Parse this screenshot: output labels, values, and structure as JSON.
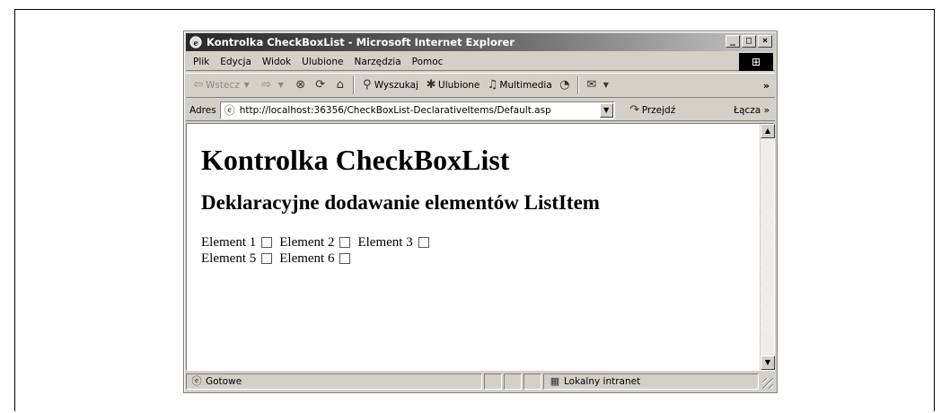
{
  "window": {
    "title": "Kontrolka CheckBoxList - Microsoft Internet Explorer",
    "buttons": {
      "minimize": "_",
      "maximize": "□",
      "close": "×"
    }
  },
  "menu": [
    "Plik",
    "Edycja",
    "Widok",
    "Ulubione",
    "Narzędzia",
    "Pomoc"
  ],
  "toolbar": {
    "back": "Wstecz",
    "search": "Wyszukaj",
    "favorites": "Ulubione",
    "media": "Multimedia",
    "more": "»"
  },
  "address": {
    "label": "Adres",
    "url": "http://localhost:36356/CheckBoxList-DeclarativeItems/Default.asp",
    "go": "Przejdź",
    "links": "Łącza »"
  },
  "page": {
    "heading": "Kontrolka CheckBoxList",
    "subheading": "Deklaracyjne dodawanie elementów ListItem",
    "checkbox_rows": [
      [
        "Element 1",
        "Element 2",
        "Element 3"
      ],
      [
        "Element 5",
        "Element 6"
      ]
    ]
  },
  "status": {
    "text": "Gotowe",
    "zone": "Lokalny intranet"
  }
}
